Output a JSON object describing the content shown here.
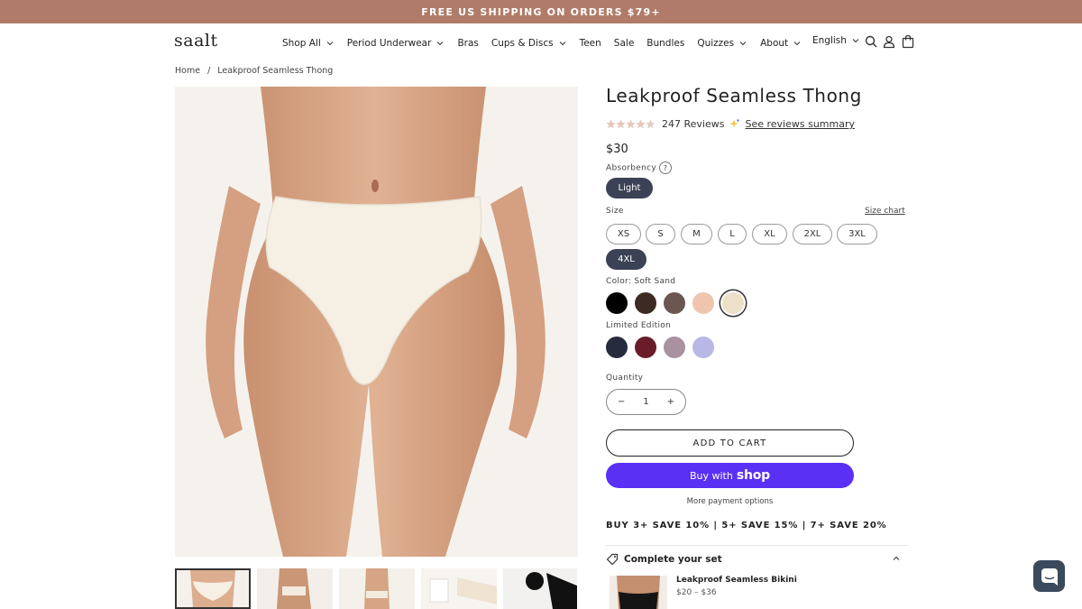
{
  "announcement": "FREE US SHIPPING ON ORDERS $79+",
  "header": {
    "logo": "saalt",
    "nav": [
      "Shop All",
      "Period Underwear",
      "Bras",
      "Cups & Discs",
      "Teen",
      "Sale",
      "Bundles",
      "Quizzes",
      "About"
    ],
    "nav_has_dropdown": [
      true,
      true,
      false,
      true,
      false,
      false,
      false,
      true,
      true
    ],
    "language": "English",
    "icons": [
      "search-icon",
      "account-icon",
      "cart-icon"
    ]
  },
  "breadcrumb": {
    "home": "Home",
    "separator": "/",
    "current": "Leakproof Seamless Thong"
  },
  "product": {
    "title": "Leakproof Seamless Thong",
    "rating": 4.5,
    "reviews_count": "247 Reviews",
    "reviews_summary_link": "See reviews summary",
    "price": "$30",
    "absorbency_label": "Absorbency",
    "absorbency_help": "?",
    "absorbency_options": [
      "Light"
    ],
    "absorbency_selected": "Light",
    "size_label": "Size",
    "size_chart": "Size chart",
    "sizes": [
      "XS",
      "S",
      "M",
      "L",
      "XL",
      "2XL",
      "3XL",
      "4XL"
    ],
    "size_selected": "4XL",
    "color_label": "Color: Soft Sand",
    "colors": [
      "#000000",
      "#3d2a22",
      "#6b5651",
      "#efc5b0",
      "#ece0c8"
    ],
    "color_selected_index": 4,
    "limited_label": "Limited Edition",
    "limited_colors": [
      "#262c3e",
      "#6a1c2a",
      "#a991a0",
      "#b9b7e5"
    ],
    "quantity_label": "Quantity",
    "quantity_minus": "−",
    "quantity_value": "1",
    "quantity_plus": "+",
    "add_to_cart": "ADD TO CART",
    "buy_with": "Buy with",
    "buy_with_brand": "shop",
    "more_payment": "More payment options",
    "promo": "BUY 3+ SAVE 10% | 5+ SAVE 15% | 7+ SAVE 20%"
  },
  "complete_set": {
    "title": "Complete your set",
    "item_name": "Leakproof Seamless Bikini",
    "item_price": "$20 – $36"
  },
  "colors": {
    "announcement": "#b07b68",
    "selected_pill": "#3b4256",
    "shop_pay": "#5a31f4",
    "chat": "#3a4a5c"
  }
}
